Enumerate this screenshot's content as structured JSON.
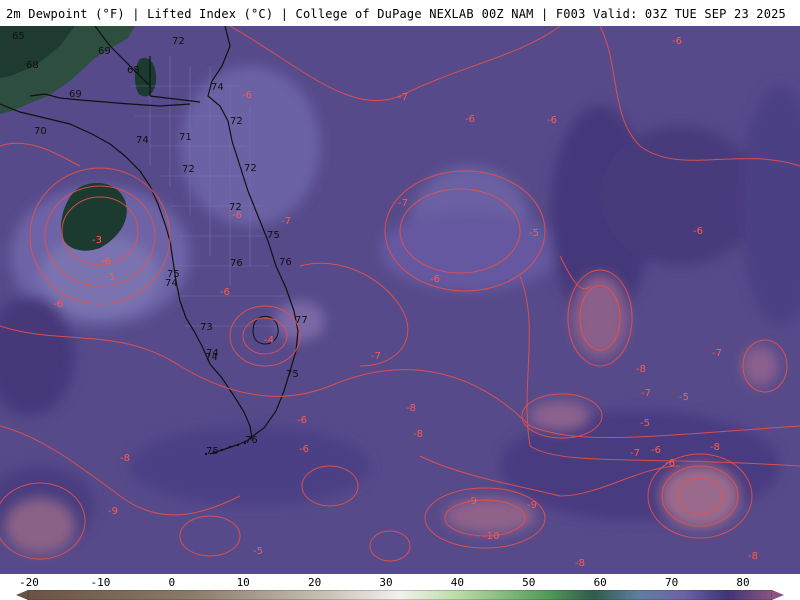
{
  "header": {
    "title_left": "2m Dewpoint (°F) | Lifted Index (°C) | College of DuPage NEXLAB",
    "title_right": "00Z NAM | F003 Valid: 03Z TUE SEP 23 2025"
  },
  "map": {
    "dewpoint_labels": [
      "65",
      "65",
      "68",
      "69",
      "69",
      "68",
      "72",
      "72",
      "74",
      "74",
      "71",
      "72",
      "72",
      "72",
      "75",
      "76",
      "76",
      "75",
      "74",
      "73",
      "74",
      "77",
      "75",
      "75",
      "76",
      "70",
      "74"
    ],
    "lifted_index_labels": [
      "-6",
      "-6",
      "-7",
      "-6",
      "-6",
      "-6",
      "-7",
      "-5",
      "-6",
      "-6",
      "-3",
      "-6",
      "-5",
      "-6",
      "-6",
      "-4",
      "-6",
      "-7",
      "-7",
      "-8",
      "-8",
      "-8",
      "-7",
      "-5",
      "-8",
      "-6",
      "-7",
      "-6",
      "-8",
      "-9",
      "-9",
      "-9",
      "-10",
      "-8",
      "-5",
      "-8",
      "-6",
      "-5",
      "-7"
    ]
  },
  "colorbar": {
    "ticks": [
      "-20",
      "-10",
      "0",
      "10",
      "20",
      "30",
      "40",
      "50",
      "60",
      "70",
      "80"
    ]
  },
  "colors": {
    "background_purple": "#564a8a",
    "contour_red": "#e8504a",
    "coast_black": "#111111",
    "low_dewpoint_green": "#2e4e3f",
    "dark_green": "#1b3a30"
  }
}
